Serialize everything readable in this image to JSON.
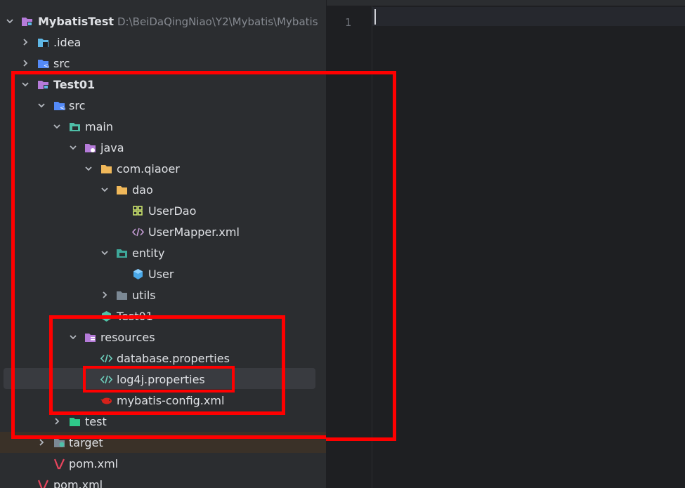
{
  "project": {
    "name": "MybatisTest",
    "path": "D:\\BeiDaQingNiao\\Y2\\Mybatis\\Mybatis"
  },
  "tree": {
    "idea": ".idea",
    "src_top": "src",
    "test01": "Test01",
    "src": "src",
    "main": "main",
    "java": "java",
    "package": "com.qiaoer",
    "dao": "dao",
    "userdao": "UserDao",
    "usermapper": "UserMapper.xml",
    "entity": "entity",
    "user": "User",
    "utils": "utils",
    "test01_class": "Test01",
    "resources": "resources",
    "database_props": "database.properties",
    "log4j_props": "log4j.properties",
    "mybatis_config": "mybatis-config.xml",
    "test": "test",
    "target": "target",
    "pom_inner": "pom.xml",
    "pom_outer": "pom.xml"
  },
  "editor": {
    "line_number": "1"
  },
  "colors": {
    "highlight_box": "#ff0000",
    "selected_row": "#393b40",
    "panel_bg": "#2b2d30",
    "editor_bg": "#1e1f22"
  }
}
